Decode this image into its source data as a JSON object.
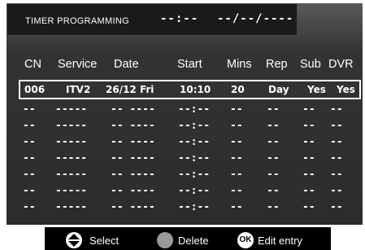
{
  "header": {
    "title": "TIMER PROGRAMMING",
    "time": "--:--",
    "date": "--/--/----"
  },
  "columns": [
    "CN",
    "Service",
    "Date",
    "Start",
    "Mins",
    "Rep",
    "Sub",
    "DVR"
  ],
  "selected_row": {
    "cn": "006",
    "service": "ITV2",
    "date": "26/12 Fri",
    "start": "10:10",
    "mins": "20",
    "rep": "Day",
    "sub": "Yes",
    "dvr": "Yes"
  },
  "empty_row": {
    "cn": "--",
    "service": "-----",
    "date": "-- ----",
    "start": "--:--",
    "mins": "--",
    "rep": "--",
    "sub": "--",
    "dvr": "--"
  },
  "footer": {
    "select_label": "Select",
    "delete_label": "Delete",
    "ok_icon_label": "OK",
    "edit_label": "Edit  entry"
  },
  "colors": {
    "background": "#333333",
    "text": "#ffffff",
    "delete_button": "#9a9a9a"
  }
}
